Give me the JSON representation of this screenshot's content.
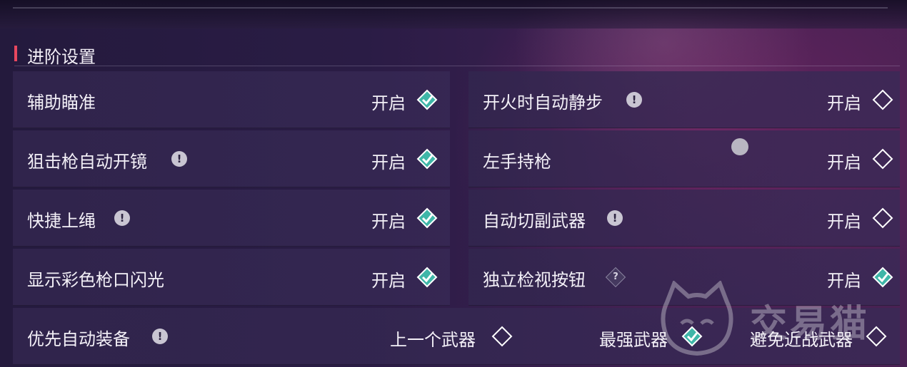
{
  "section": {
    "title": "进阶设置"
  },
  "settings": [
    {
      "label": "辅助瞄准",
      "value": "开启",
      "checked": true,
      "info": "none"
    },
    {
      "label": "开火时自动静步",
      "value": "开启",
      "checked": false,
      "info": "!"
    },
    {
      "label": "狙击枪自动开镜",
      "value": "开启",
      "checked": true,
      "info": "!"
    },
    {
      "label": "左手持枪",
      "value": "开启",
      "checked": false,
      "info": "none"
    },
    {
      "label": "快捷上绳",
      "value": "开启",
      "checked": true,
      "info": "!"
    },
    {
      "label": "自动切副武器",
      "value": "开启",
      "checked": false,
      "info": "!"
    },
    {
      "label": "显示彩色枪口闪光",
      "value": "开启",
      "checked": true,
      "info": "none"
    },
    {
      "label": "独立检视按钮",
      "value": "开启",
      "checked": true,
      "info": "?"
    }
  ],
  "auto_equip": {
    "label": "优先自动装备",
    "info": "!",
    "options": [
      {
        "label": "上一个武器",
        "checked": false
      },
      {
        "label": "最强武器",
        "checked": true
      },
      {
        "label": "避免近战武器",
        "checked": false
      }
    ]
  },
  "badges": {
    "info": "!",
    "question": "?"
  },
  "watermark": {
    "text": "交易猫"
  },
  "colors": {
    "accent": "#e8475f",
    "checked": "#3fb6a8",
    "panel": "#32264e"
  }
}
